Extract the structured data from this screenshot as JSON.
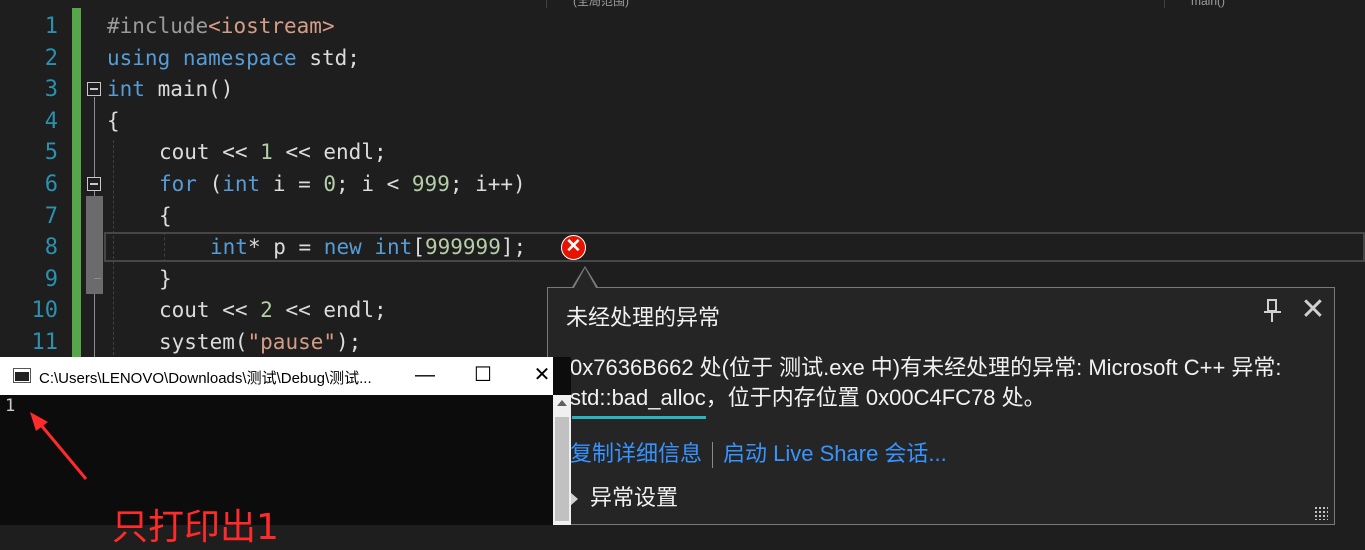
{
  "tabs": {
    "scope": "(全局范围)",
    "member": "main()"
  },
  "line_numbers": [
    "1",
    "2",
    "3",
    "4",
    "5",
    "6",
    "7",
    "8",
    "9",
    "10",
    "11"
  ],
  "code": {
    "l1": {
      "pp": "#include",
      "inc": "<iostream>"
    },
    "l2": {
      "kw1": "using",
      "kw2": "namespace",
      "rest": " std;"
    },
    "l3": {
      "kw": "int",
      "rest": " main()"
    },
    "l4": {
      "text": "{"
    },
    "l5": {
      "a": "cout << ",
      "n1": "1",
      "b": " << endl;"
    },
    "l6": {
      "kw1": "for",
      "a": " (",
      "kw2": "int",
      "b": " i = ",
      "n1": "0",
      "c": "; i < ",
      "n2": "999",
      "d": "; i++)"
    },
    "l7": {
      "text": "{"
    },
    "l8": {
      "kw1": "int",
      "a": "* p = ",
      "kw2": "new",
      "b": " ",
      "kw3": "int",
      "c": "[",
      "n1": "999999",
      "d": "];"
    },
    "l9": {
      "text": "}"
    },
    "l10": {
      "a": "cout << ",
      "n1": "2",
      "b": " << endl;"
    },
    "l11": {
      "a": "system(",
      "s": "\"pause\"",
      "b": ");"
    }
  },
  "exception_popup": {
    "title": "未经处理的异常",
    "message_part1": "0x7636B662 处(位于 测试.exe 中)有未经处理的异常: Microsoft C++ 异常: ",
    "message_highlight": "std::bad_alloc",
    "message_part2": "，位于内存位置 0x00C4FC78 处。",
    "link_copy": "复制详细信息",
    "link_liveshare": "启动 Live Share 会话...",
    "settings_label": "异常设置",
    "error_glyph": "✕",
    "close_glyph": "✕"
  },
  "console": {
    "title": "C:\\Users\\LENOVO\\Downloads\\测试\\Debug\\测试...",
    "output": "1",
    "minimize_glyph": "—",
    "maximize_glyph": "☐",
    "close_glyph": "✕"
  },
  "annotation": {
    "text": "只打印出1",
    "color": "#ff2b2b"
  },
  "colors": {
    "keyword": "#569cd6",
    "number": "#b5cea8",
    "string": "#d69d85",
    "line_number": "#2b91af",
    "link": "#3794ff",
    "error": "#e51400"
  }
}
